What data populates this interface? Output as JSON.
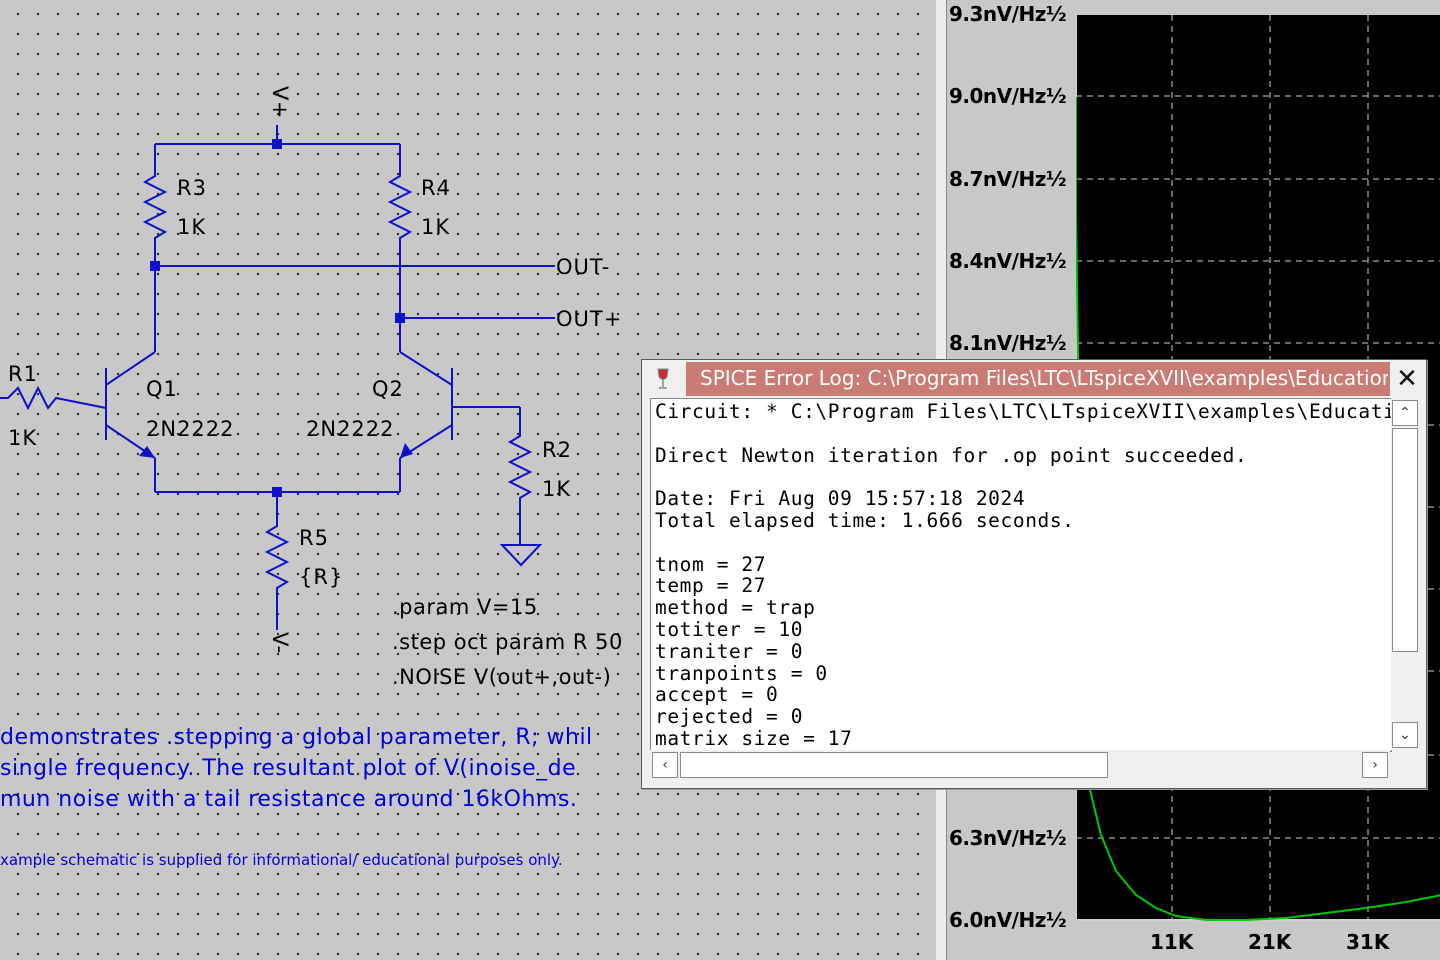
{
  "schematic": {
    "supply_pos": "V+",
    "supply_neg": "V-",
    "components": {
      "r1": {
        "name": "R1",
        "value": "1K"
      },
      "r2": {
        "name": "R2",
        "value": "1K"
      },
      "r3": {
        "name": "R3",
        "value": "1K"
      },
      "r4": {
        "name": "R4",
        "value": "1K"
      },
      "r5": {
        "name": "R5",
        "value": "{R}"
      },
      "q1": {
        "name": "Q1",
        "value": "2N2222"
      },
      "q2": {
        "name": "Q2",
        "value": "2N2222"
      }
    },
    "nets": {
      "out_minus": "OUT-",
      "out_plus": "OUT+"
    },
    "directives": [
      ".param V=15",
      ".step oct param R 50",
      ".NOISE V(out+,out-)"
    ],
    "comments": [
      "demonstrates .stepping a global parameter, R; whil",
      "single frequency.  The resultant plot of V(inoise_de",
      "mun noise with a tail resistance around 16kOhms."
    ],
    "disclaimer": "xample schematic is supplied for informational/ educational purposes only."
  },
  "plot": {
    "y_ticks": [
      "9.3nV/Hz½",
      "9.0nV/Hz½",
      "8.7nV/Hz½",
      "8.4nV/Hz½",
      "8.1nV/Hz½",
      "6.3nV/Hz½",
      "6.0nV/Hz½"
    ],
    "x_ticks": [
      "11K",
      "21K",
      "31K"
    ],
    "colors": {
      "background": "#000000",
      "trace": "#00c800",
      "grid": "#8a8a8a"
    }
  },
  "error_log": {
    "title": "SPICE Error Log: C:\\Program Files\\LTC\\LTspiceXVII\\examples\\Educational\\NoiseMin.asc",
    "close_label": "✕",
    "lines": [
      "Circuit: * C:\\Program Files\\LTC\\LTspiceXVII\\examples\\Educational\\NoiseMin.asc",
      "",
      "Direct Newton iteration for .op point succeeded.",
      "",
      "Date: Fri Aug 09 15:57:18 2024",
      "Total elapsed time: 1.666 seconds.",
      "",
      "tnom = 27",
      "temp = 27",
      "method = trap",
      "totiter = 10",
      "traniter = 0",
      "tranpoints = 0",
      "accept = 0",
      "rejected = 0",
      "matrix size = 17"
    ]
  }
}
